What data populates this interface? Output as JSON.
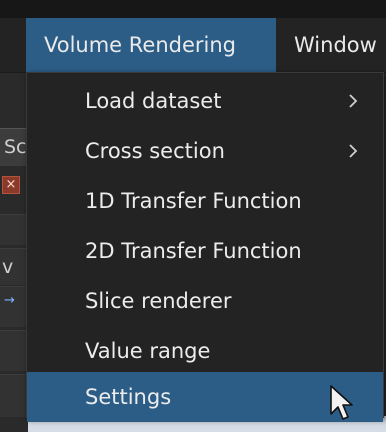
{
  "menubar": {
    "active_menu": "Volume Rendering",
    "next_menu": "Window"
  },
  "background": {
    "tab_fragment": "Sc",
    "row_fragment": "v",
    "close_glyph": "×",
    "arrow_glyph": "→"
  },
  "menu": {
    "items": [
      {
        "label": "Load dataset",
        "has_submenu": true
      },
      {
        "label": "Cross section",
        "has_submenu": true
      },
      {
        "label": "1D Transfer Function",
        "has_submenu": false
      },
      {
        "label": "2D Transfer Function",
        "has_submenu": false
      },
      {
        "label": "Slice renderer",
        "has_submenu": false
      },
      {
        "label": "Value range",
        "has_submenu": false
      },
      {
        "label": "Settings",
        "has_submenu": false,
        "highlighted": true
      }
    ]
  },
  "icons": {
    "submenu": "chevron-right-icon",
    "pointer": "mouse-cursor-icon"
  },
  "colors": {
    "highlight": "#2c5d87",
    "menu_bg": "#232323",
    "text": "#ececec"
  }
}
